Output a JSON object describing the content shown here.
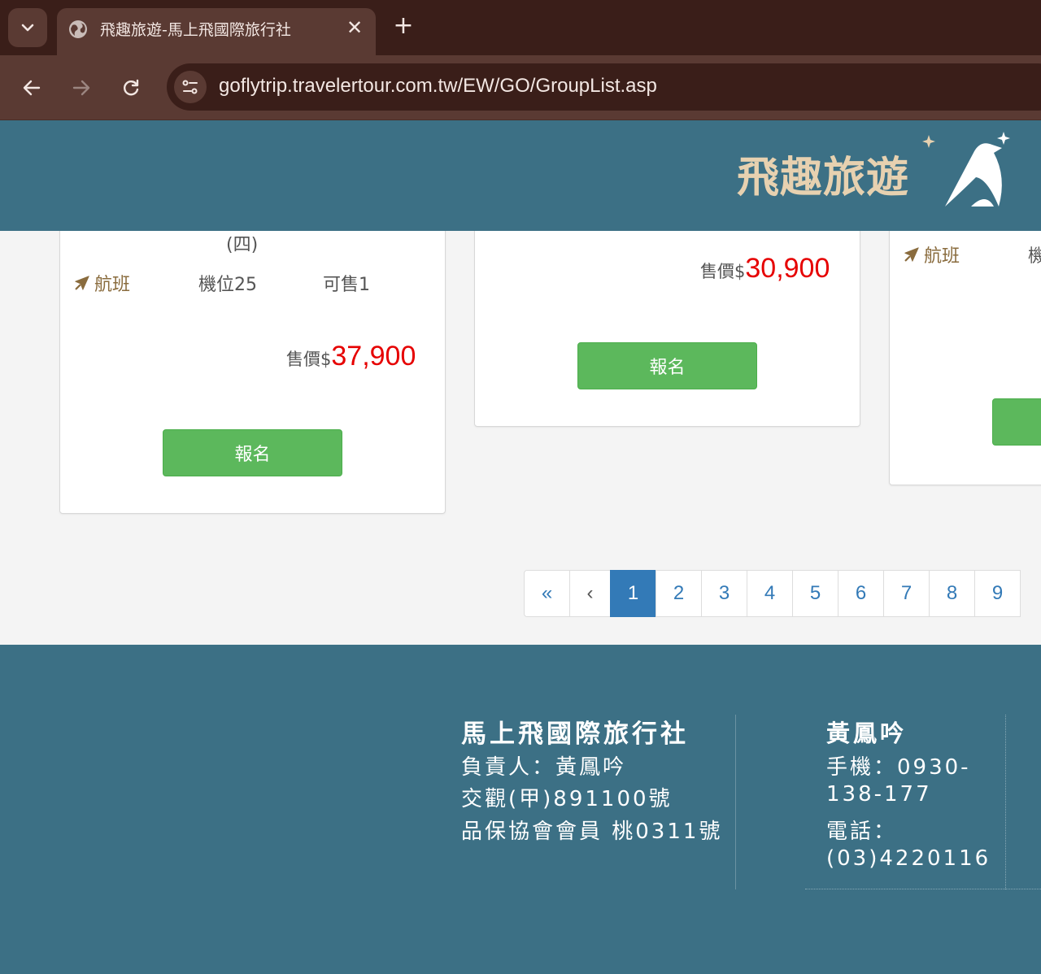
{
  "browser": {
    "tab_title": "飛趣旅遊-馬上飛國際旅行社",
    "url": "goflytrip.travelertour.com.tw/EW/GO/GroupList.asp"
  },
  "header": {
    "logo_text": "飛趣旅遊",
    "brand_color": "#3c7085",
    "logo_color": "#e7d1b0"
  },
  "cards": [
    {
      "date_fragment": "(四)",
      "flight_label": "航班",
      "seats": "機位25",
      "available": "可售1",
      "price_prefix": "售價$",
      "price": "37,900",
      "signup_label": "報名"
    },
    {
      "price_prefix": "售價$",
      "price": "30,900",
      "signup_label": "報名"
    },
    {
      "flight_label": "航班",
      "seats_fragment": "機"
    }
  ],
  "pagination": {
    "first": "«",
    "prev": "‹",
    "pages": [
      "1",
      "2",
      "3",
      "4",
      "5",
      "6",
      "7",
      "8",
      "9"
    ],
    "active": "1"
  },
  "footer": {
    "company": "馬上飛國際旅行社",
    "lines": [
      "負責人：黃鳳吟",
      "交觀(甲)891100號",
      "品保協會會員 桃0311號"
    ],
    "contact_name": "黃鳳吟",
    "contact_lines": [
      "手機：0930-",
      "138-177",
      "電話：",
      "(03)4220116"
    ]
  },
  "colors": {
    "price_red": "#e60000",
    "signup_green": "#5cb85c",
    "pagination_active": "#337ab7",
    "flight_brown": "#8a6c3e"
  }
}
